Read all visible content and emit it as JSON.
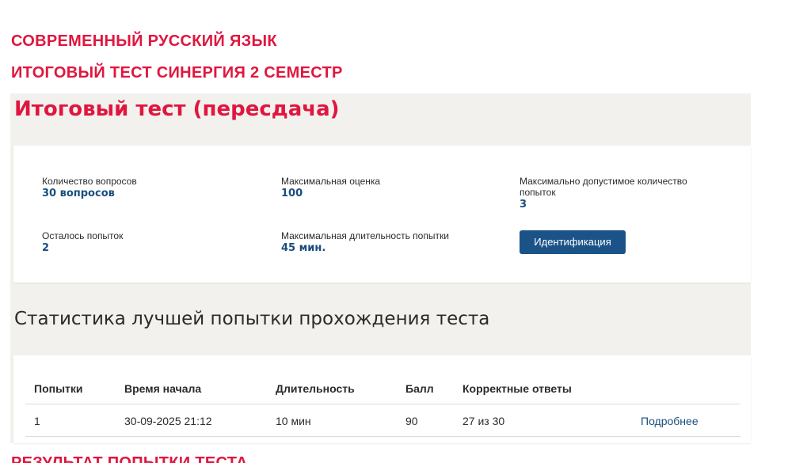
{
  "header": {
    "line1": "СОВРЕМЕННЫЙ  РУССКИЙ ЯЗЫК",
    "line2": "ИТОГОВЫЙ ТЕСТ СИНЕРГИЯ  2 СЕМЕСТР",
    "line3": "РЕЗУЛЬТАТ ПОПЫТКИ ТЕСТА"
  },
  "test": {
    "title": "Итоговый тест (пересдача)",
    "info": [
      {
        "label": "Количество вопросов",
        "value": "30 вопросов"
      },
      {
        "label": "Максимальная оценка",
        "value": "100"
      },
      {
        "label": "Максимально допустимое количество попыток",
        "value": "3"
      },
      {
        "label": "Осталось попыток",
        "value": "2"
      },
      {
        "label": "Максимальная длительность попытки",
        "value": "45 мин."
      }
    ],
    "identify_button": "Идентификация"
  },
  "stats": {
    "title": "Статистика лучшей попытки прохождения теста",
    "columns": [
      "Попытки",
      "Время начала",
      "Длительность",
      "Балл",
      "Корректные ответы"
    ],
    "rows": [
      {
        "attempt": "1",
        "start": "30-09-2025 21:12",
        "duration": "10 мин",
        "score": "90",
        "correct": "27 из 30",
        "details": "Подробнее"
      }
    ]
  },
  "colors": {
    "accent_red": "#e0163f",
    "primary_blue": "#1b5388",
    "value_blue": "#1a4e7d",
    "panel_bg": "#f2f1ee"
  }
}
